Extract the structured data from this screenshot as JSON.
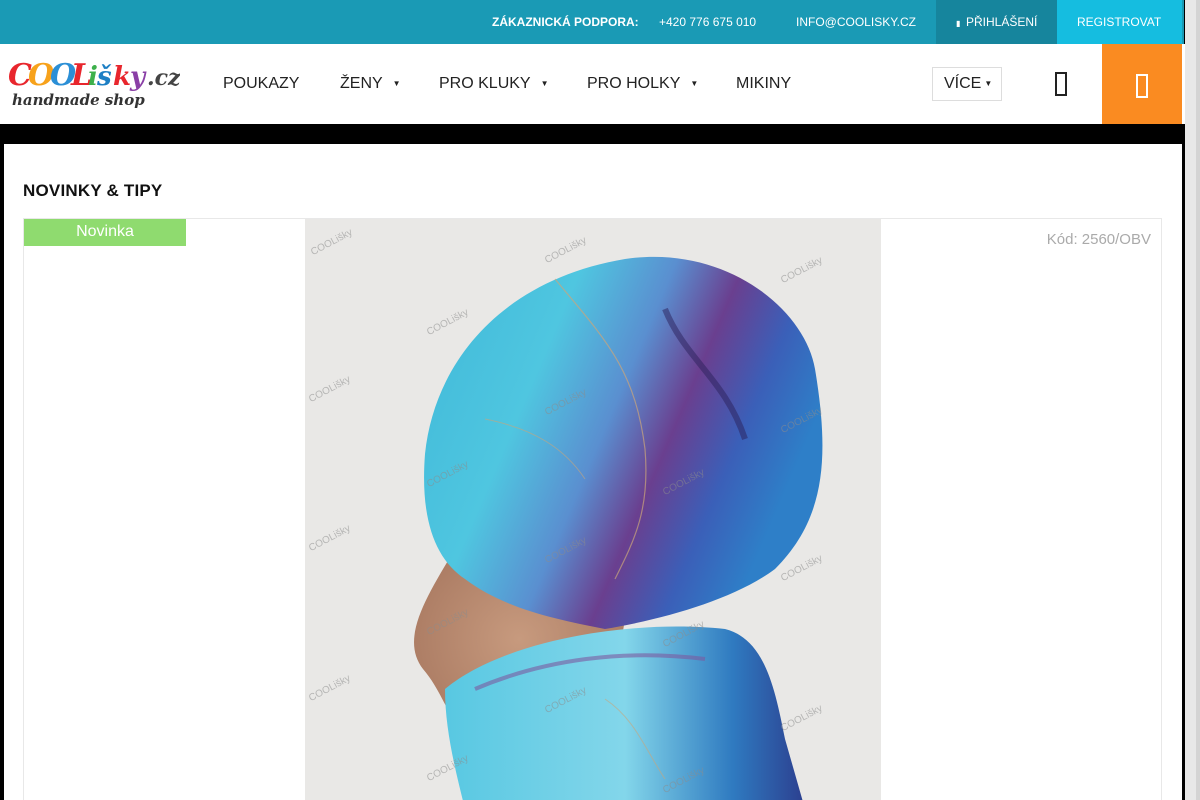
{
  "topbar": {
    "support_label": "ZÁKAZNICKÁ PODPORA:",
    "phone": "+420 776 675 010",
    "email": "INFO@COOLISKY.CZ",
    "login_label": "PŘIHLÁŠENÍ",
    "register_label": "REGISTROVAT"
  },
  "brand": {
    "name": "COOLišky.cz",
    "tagline": "handmade shop"
  },
  "nav": {
    "items": [
      {
        "label": "POUKAZY",
        "has_submenu": false
      },
      {
        "label": "ŽENY",
        "has_submenu": true
      },
      {
        "label": "PRO KLUKY",
        "has_submenu": true
      },
      {
        "label": "PRO HOLKY",
        "has_submenu": true
      },
      {
        "label": "MIKINY",
        "has_submenu": false
      }
    ],
    "more_label": "VÍCE",
    "search_icon": "search-icon",
    "cart_icon": "cart-icon"
  },
  "section": {
    "title": "NOVINKY & TIPY"
  },
  "product": {
    "badge": "Novinka",
    "code": "Kód: 2560/OBV",
    "watermark": "COOLišky"
  },
  "colors": {
    "topbar": "#1a9ab5",
    "login": "#16859d",
    "register": "#15bde0",
    "cart": "#fa8b21",
    "badge": "#8fdb6f"
  }
}
